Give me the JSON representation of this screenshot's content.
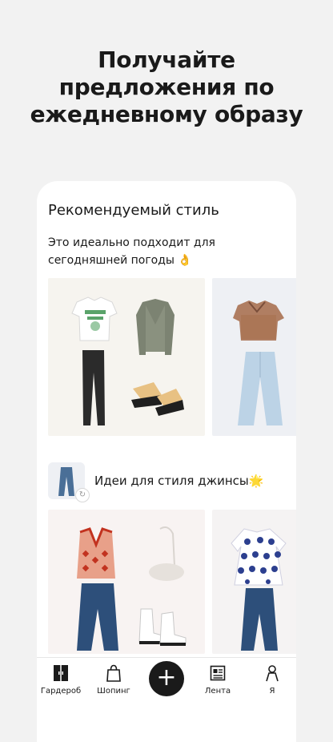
{
  "headline": {
    "line1": "Получайте",
    "line2": "предложения по",
    "line3": "ежедневному образу"
  },
  "recommended": {
    "title": "Рекомендуемый стиль",
    "desc_line1": "Это идеально подходит для",
    "desc_line2": "сегодняшней погоды 👌"
  },
  "jeans_section": {
    "title": "Идеи для стиля джинсы🌟"
  },
  "tabbar": {
    "wardrobe": "Гардероб",
    "shopping": "Шопинг",
    "add": "+",
    "feed": "Лента",
    "profile": "Я"
  }
}
